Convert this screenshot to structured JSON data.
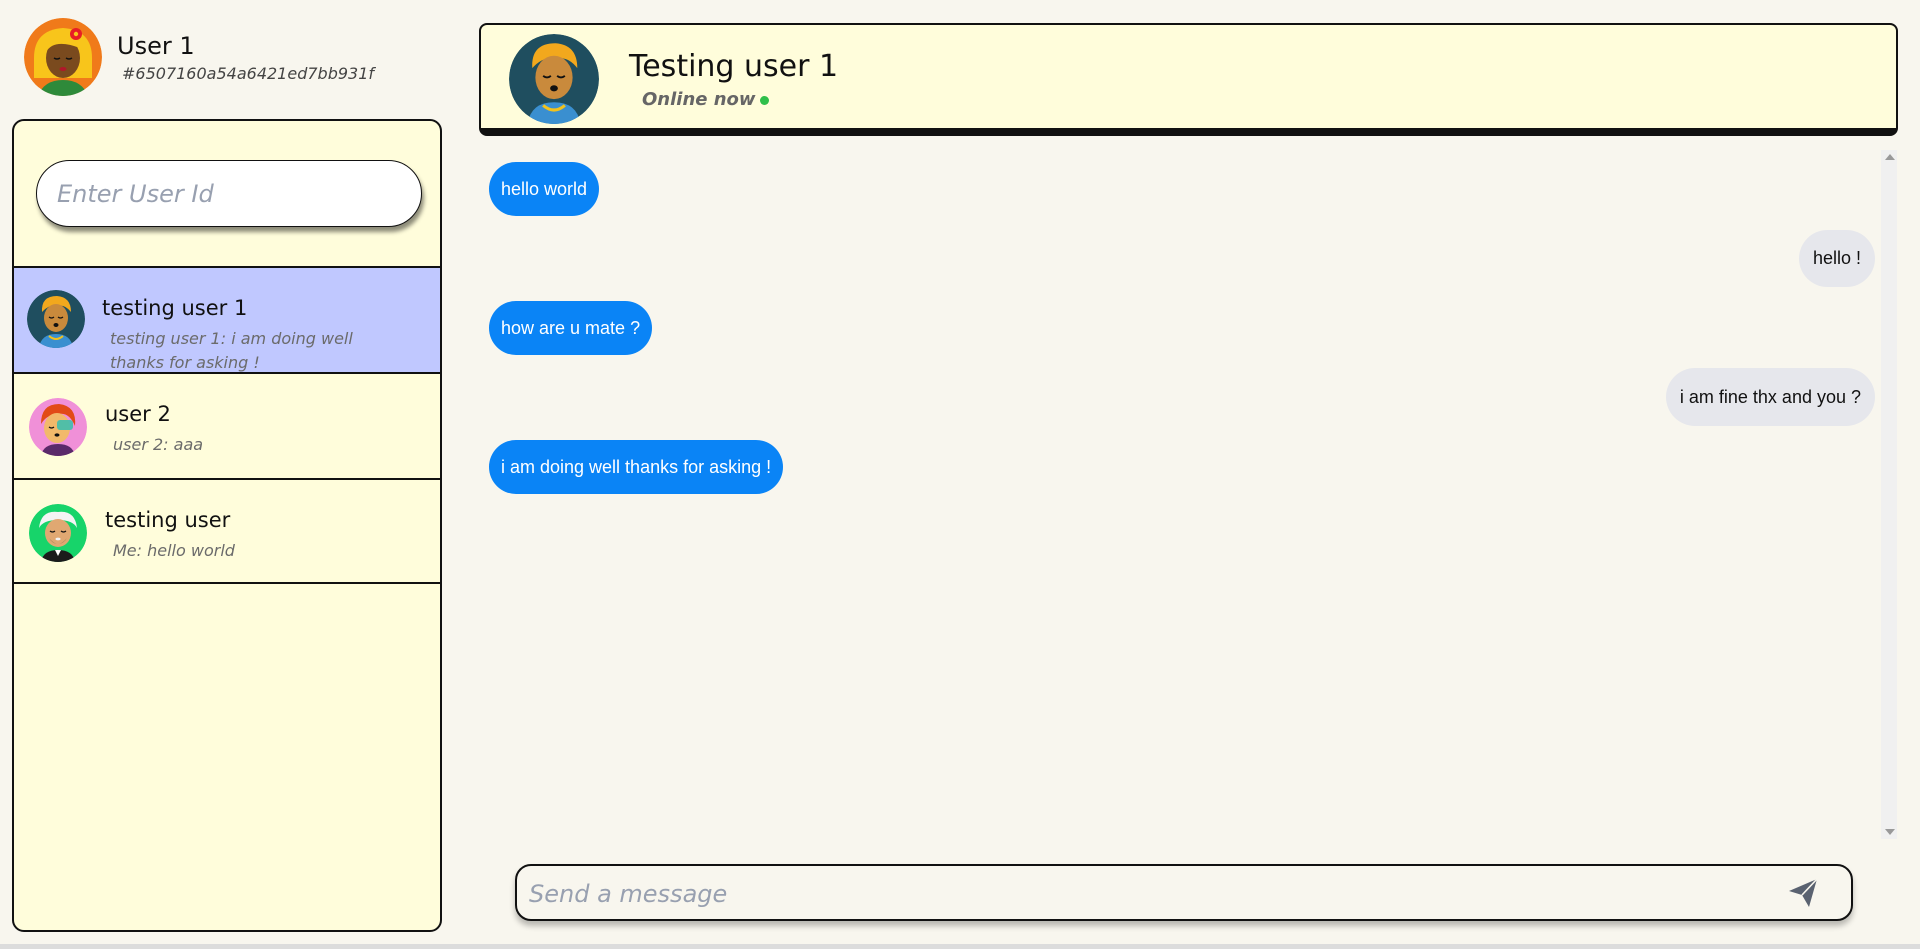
{
  "current_user": {
    "name": "User 1",
    "id": "#6507160a54a6421ed7bb931f"
  },
  "search": {
    "placeholder": "Enter User Id"
  },
  "conversations": [
    {
      "name": "testing user 1",
      "preview": "testing user 1: i am doing well thanks for asking !",
      "active": true
    },
    {
      "name": "user 2",
      "preview": "user 2: aaa",
      "active": false
    },
    {
      "name": "testing user",
      "preview": "Me: hello world",
      "active": false
    }
  ],
  "chat": {
    "title": "Testing user 1",
    "status": "Online now"
  },
  "messages": [
    {
      "text": "hello world",
      "direction": "in"
    },
    {
      "text": "hello !",
      "direction": "out"
    },
    {
      "text": "how are u mate ?",
      "direction": "in"
    },
    {
      "text": "i am fine thx and you ?",
      "direction": "out"
    },
    {
      "text": "i am doing well thanks for asking !",
      "direction": "in"
    }
  ],
  "composer": {
    "placeholder": "Send a message"
  },
  "icons": {
    "send": "send-icon",
    "online": "online-dot-icon"
  },
  "colors": {
    "incoming": "#0a84f6",
    "outgoing": "#e6e7ec",
    "active_conversation": "#c0c8ff",
    "panel": "#fffddb",
    "online": "#2fbf4a"
  }
}
